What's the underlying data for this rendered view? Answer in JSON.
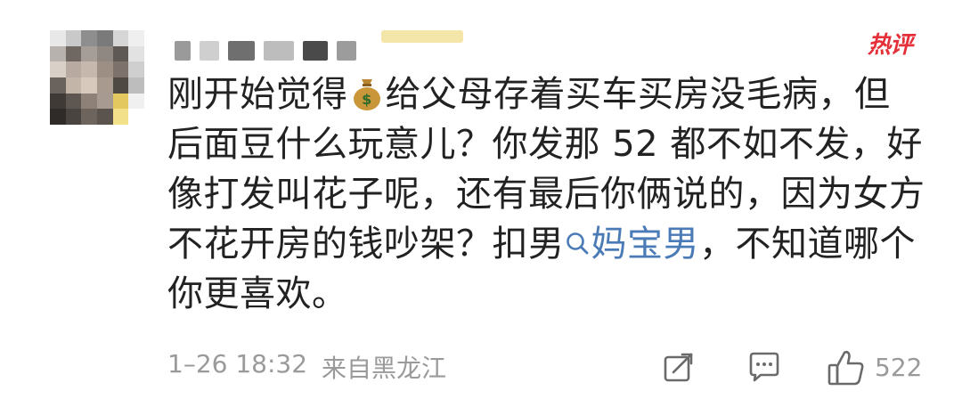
{
  "comment": {
    "hot_label": "热评",
    "lines": [
      {
        "before": "刚开始觉得",
        "icon": "money-bag-icon",
        "after": "给父母存着买车买房没毛病，但"
      },
      {
        "text": "后面豆什么玩意儿？你发那 52 都不如不发，好"
      },
      {
        "text": "像打发叫花子呢，还有最后你俩说的，因为女方"
      },
      {
        "before": "不花开房的钱吵架？扣男",
        "topic": "妈宝男",
        "after": "，不知道哪个"
      },
      {
        "text": "你更喜欢。"
      }
    ],
    "meta": {
      "time": "1–26 18:32",
      "location": "来自黑龙江"
    },
    "actions": {
      "like_count": "522"
    }
  },
  "colors": {
    "hot": "#e5303a",
    "topic_link": "#4a7bb7",
    "meta_text": "#9a9a9a"
  }
}
